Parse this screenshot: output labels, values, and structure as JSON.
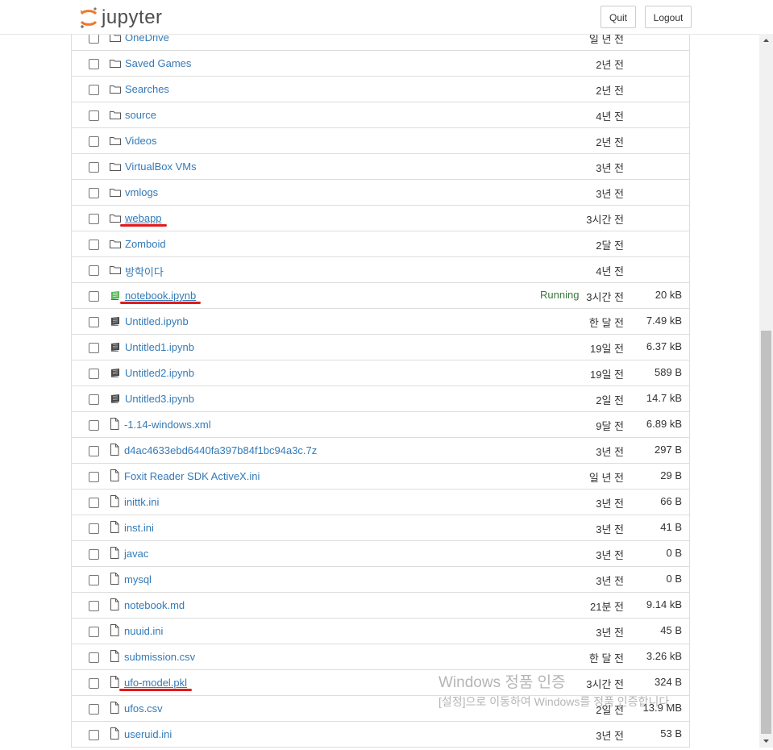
{
  "header": {
    "logo_text": "jupyter",
    "quit_label": "Quit",
    "logout_label": "Logout"
  },
  "files": [
    {
      "name": "OneDrive",
      "type": "folder",
      "modified": "일 년 전",
      "size": "",
      "status": ""
    },
    {
      "name": "Saved Games",
      "type": "folder",
      "modified": "2년 전",
      "size": "",
      "status": ""
    },
    {
      "name": "Searches",
      "type": "folder",
      "modified": "2년 전",
      "size": "",
      "status": ""
    },
    {
      "name": "source",
      "type": "folder",
      "modified": "4년 전",
      "size": "",
      "status": ""
    },
    {
      "name": "Videos",
      "type": "folder",
      "modified": "2년 전",
      "size": "",
      "status": ""
    },
    {
      "name": "VirtualBox VMs",
      "type": "folder",
      "modified": "3년 전",
      "size": "",
      "status": ""
    },
    {
      "name": "vmlogs",
      "type": "folder",
      "modified": "3년 전",
      "size": "",
      "status": ""
    },
    {
      "name": "webapp",
      "type": "folder",
      "modified": "3시간 전",
      "size": "",
      "status": ""
    },
    {
      "name": "Zomboid",
      "type": "folder",
      "modified": "2달 전",
      "size": "",
      "status": ""
    },
    {
      "name": "방학이다",
      "type": "folder",
      "modified": "4년 전",
      "size": "",
      "status": ""
    },
    {
      "name": "notebook.ipynb",
      "type": "notebook-running",
      "modified": "3시간 전",
      "size": "20 kB",
      "status": "Running"
    },
    {
      "name": "Untitled.ipynb",
      "type": "notebook",
      "modified": "한 달 전",
      "size": "7.49 kB",
      "status": ""
    },
    {
      "name": "Untitled1.ipynb",
      "type": "notebook",
      "modified": "19일 전",
      "size": "6.37 kB",
      "status": ""
    },
    {
      "name": "Untitled2.ipynb",
      "type": "notebook",
      "modified": "19일 전",
      "size": "589 B",
      "status": ""
    },
    {
      "name": "Untitled3.ipynb",
      "type": "notebook",
      "modified": "2일 전",
      "size": "14.7 kB",
      "status": ""
    },
    {
      "name": "-1.14-windows.xml",
      "type": "file",
      "modified": "9달 전",
      "size": "6.89 kB",
      "status": ""
    },
    {
      "name": "d4ac4633ebd6440fa397b84f1bc94a3c.7z",
      "type": "file",
      "modified": "3년 전",
      "size": "297 B",
      "status": ""
    },
    {
      "name": "Foxit Reader SDK ActiveX.ini",
      "type": "file",
      "modified": "일 년 전",
      "size": "29 B",
      "status": ""
    },
    {
      "name": "inittk.ini",
      "type": "file",
      "modified": "3년 전",
      "size": "66 B",
      "status": ""
    },
    {
      "name": "inst.ini",
      "type": "file",
      "modified": "3년 전",
      "size": "41 B",
      "status": ""
    },
    {
      "name": "javac",
      "type": "file",
      "modified": "3년 전",
      "size": "0 B",
      "status": ""
    },
    {
      "name": "mysql",
      "type": "file",
      "modified": "3년 전",
      "size": "0 B",
      "status": ""
    },
    {
      "name": "notebook.md",
      "type": "file",
      "modified": "21분 전",
      "size": "9.14 kB",
      "status": ""
    },
    {
      "name": "nuuid.ini",
      "type": "file",
      "modified": "3년 전",
      "size": "45 B",
      "status": ""
    },
    {
      "name": "submission.csv",
      "type": "file",
      "modified": "한 달 전",
      "size": "3.26 kB",
      "status": ""
    },
    {
      "name": "ufo-model.pkl",
      "type": "file",
      "modified": "3시간 전",
      "size": "324 B",
      "status": ""
    },
    {
      "name": "ufos.csv",
      "type": "file",
      "modified": "2일 전",
      "size": "13.9 MB",
      "status": ""
    },
    {
      "name": "useruid.ini",
      "type": "file",
      "modified": "3년 전",
      "size": "53 B",
      "status": ""
    }
  ],
  "highlighted": [
    "webapp",
    "notebook.ipynb",
    "ufo-model.pkl"
  ],
  "watermark": {
    "line1": "Windows 정품 인증",
    "line2": "[설정]으로 이동하여 Windows를 정품 인증합니다."
  },
  "colors": {
    "link": "#337ab7",
    "running": "#3c763d",
    "annotation": "#e31a1c"
  }
}
